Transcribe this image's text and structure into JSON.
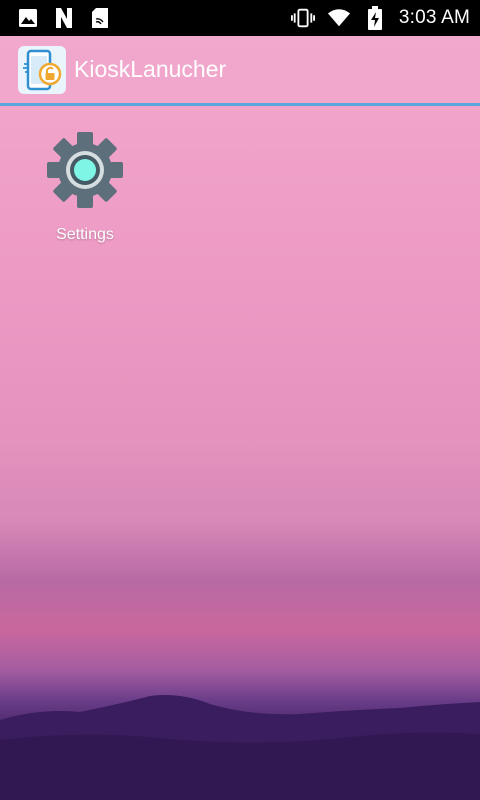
{
  "status_bar": {
    "left_icons": [
      "image-icon",
      "n-icon",
      "sd-card-icon"
    ],
    "right_icons": [
      "vibrate-icon",
      "wifi-icon",
      "battery-charging-icon"
    ],
    "time": "3:03 AM"
  },
  "action_bar": {
    "app_icon": "kiosk-app-icon",
    "title": "KioskLanucher"
  },
  "launcher": {
    "apps": [
      {
        "label": "Settings",
        "icon": "settings-gear-icon"
      }
    ]
  },
  "colors": {
    "action_bar_divider": "#5aa6de",
    "gear_body": "#5c6f7b",
    "gear_center": "#7ff5e6",
    "status_bar_bg": "#000000"
  }
}
